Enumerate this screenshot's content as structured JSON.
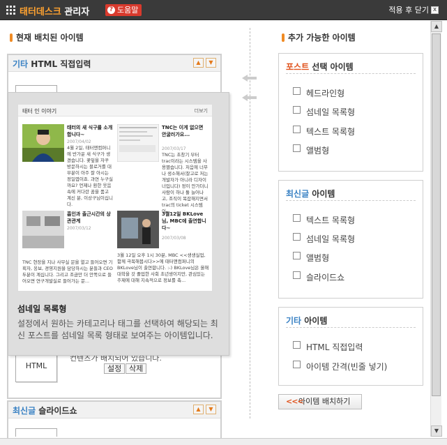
{
  "titlebar": {
    "brand": "태터데스크",
    "title": " 관리자",
    "help_label": "도움말",
    "close_label": "적용 후 닫기",
    "close_icon": "x"
  },
  "left": {
    "section_title": "현재 배치된 아이템",
    "panel_html": {
      "category": "기타",
      "name": " HTML 직접입력"
    },
    "panel_slide": {
      "category": "최신글",
      "name": " 슬라이드쇼"
    },
    "thumb_html_label": "HTML",
    "behind_text": "컨텐츠가 배치되어 있습니다.",
    "edit_label": "설정",
    "delete_label": "삭제"
  },
  "tooltip": {
    "preview_header": "태터 인 이야기",
    "preview_more": "더보기",
    "posts": [
      {
        "title": "태터의 새 식구를 소개합니다~",
        "date": "2007/04/02",
        "body": "4월 2일, 태터앤컴퍼니에 반가운 새 식구가 생겼습니다. 꽃잎을 자꾸 방문하시는 블로거를 대부분이 아주 잘 아시는 정일엽이죠. 과연 누구실까요? 언제나 환한 웃음 속에 커다란 꿈을 품고 계신 분, 이상구님이십니다."
      },
      {
        "title": "TNC는 이게 없으면 안굴러가요...",
        "date": "2007/03/17",
        "body": "TNC는 초창기 부터 trac이라는 시스템을 사용헀습니다. 처음에 너무나 생소해서(잘고로 저는 개발자가 아니라 디자이너입니다) 정이 안가더니 사람이 하나 둘 늘어나고, 조직이 복잡해지면서 trac의 ticket 시스템이..."
      },
      {
        "title": "흡인과 출근시간의 상관관계",
        "date": "2007/03/12",
        "body": "TNC 현장을 지나 사무실 문을 열고 들어오면 기획자, 웅보, 경영지원을 담당하시는 분들과 CEO 두분이 계십니다. 그리고 조금만 더 안쪽으로 들어오면 연구개발실로 들어가는 문..."
      },
      {
        "title": "3월12일 BKLove님, MBC에 출연합니다~",
        "date": "2007/03/08",
        "body": "3월 12일 오후 1시 30분, MBC <<생생실업, 함께 극복해봅시다>>에 태터앤컴퍼니의 BKLove님이 출연합니다. :-) BKLove님은 올해 대학을 갓 졸업한 사회 초년생이지만, 관심있는 주제에 대해 지속적으로 정보를 축..."
      }
    ],
    "title": "섬네일 목록형",
    "description": "설정에서 원하는 카테고리나 태그를 선택하여 해당되는 최신 포스트를 섬네일 목록 형태로 보여주는 아이템입니다."
  },
  "right": {
    "section_title": "추가 가능한 아이템",
    "groups": [
      {
        "category": "포스트",
        "suffix": " 선택 아이템",
        "color": "#e0521c",
        "items": [
          "헤드라인형",
          "섬네일 목록형",
          "텍스트 목록형",
          "앨범형"
        ]
      },
      {
        "category": "최신글",
        "suffix": " 아이템",
        "color": "#3a82c4",
        "items": [
          "텍스트 목록형",
          "섬네일 목록형",
          "앨범형",
          "슬라이드쇼"
        ]
      },
      {
        "category": "기타",
        "suffix": " 아이템",
        "color": "#3a82c4",
        "items": [
          "HTML 직접입력",
          "아이템 간격(빈줄 넣기)"
        ]
      }
    ],
    "place_button": "아이템 배치하기",
    "place_chevrons": "<<<"
  }
}
